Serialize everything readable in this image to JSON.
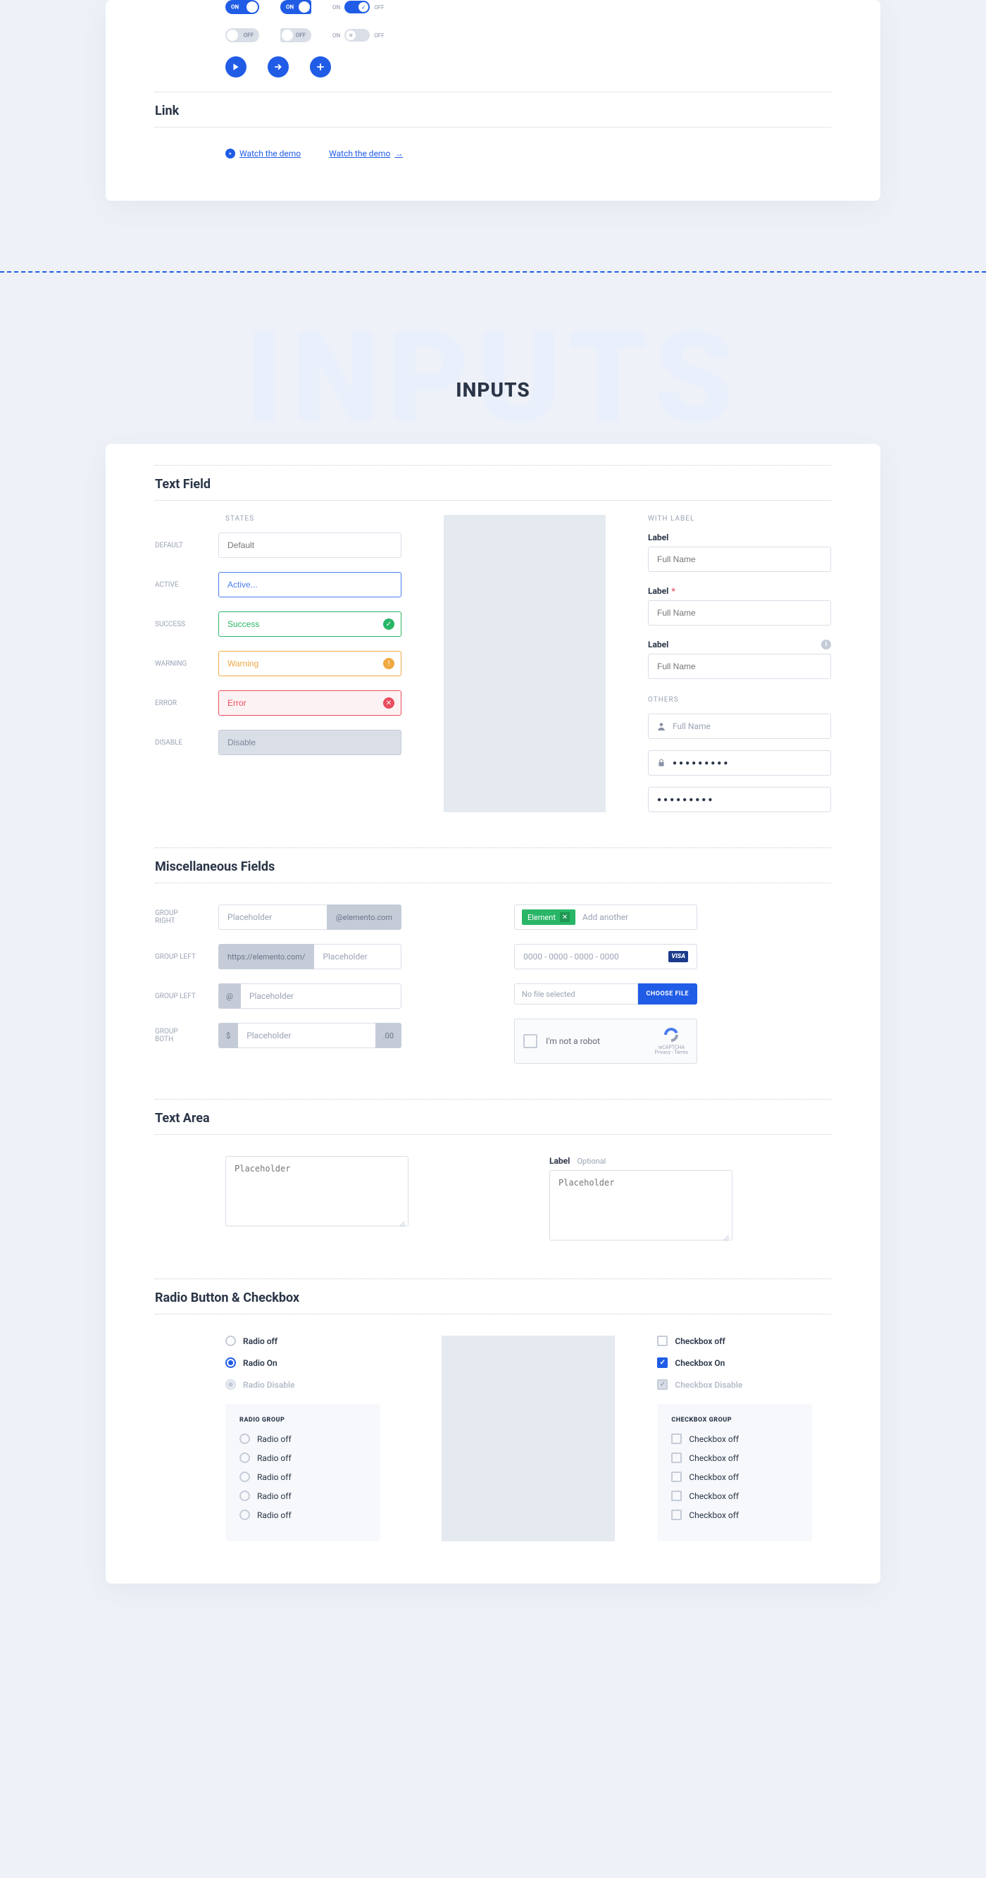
{
  "toggles": {
    "on": "ON",
    "off": "OFF"
  },
  "link": {
    "header": "Link",
    "watch1": "Watch the demo",
    "watch2": "Watch the demo"
  },
  "inputs_bg": "INPUTS",
  "inputs_title": "INPUTS",
  "textfield": {
    "header": "Text Field",
    "states_hdr": "STATES",
    "withlabel_hdr": "WITH LABEL",
    "others_hdr": "OTHERS",
    "default_lbl": "DEFAULT",
    "default_ph": "Default",
    "active_lbl": "ACTIVE",
    "active_ph": "Active...",
    "success_lbl": "SUCCESS",
    "success_ph": "Success",
    "warning_lbl": "WARNING",
    "warning_ph": "Warning",
    "error_lbl": "ERROR",
    "error_ph": "Error",
    "disable_lbl": "DISABLE",
    "disable_ph": "Disable",
    "label": "Label",
    "fullname": "Full Name",
    "password": "●●●●●●●●●",
    "password2": "●●●●●●●●●"
  },
  "misc": {
    "header": "Miscellaneous Fields",
    "gr_lbl": "GROUP RIGHT",
    "gr_ph": "Placeholder",
    "gr_addon": "@elemento.com",
    "gl_lbl": "GROUP LEFT",
    "gl_ph": "Placeholder",
    "gl_addon": "https://elemento.com/",
    "gl2_lbl": "GROUP LEFT",
    "gb_lbl": "GROUP BOTH",
    "gb_left": "$",
    "gb_right": ".00",
    "tag": "Element",
    "tag_ph": "Add another",
    "card_ph": "0000 - 0000 - 0000 - 0000",
    "visa": "VISA",
    "file_ph": "No file selected",
    "file_btn": "CHOOSE FILE",
    "captcha": "I'm not a robot",
    "captcha_logo": "reCAPTCHA",
    "captcha_sub": "Privacy - Terms"
  },
  "textarea": {
    "header": "Text Area",
    "ph": "Placeholder",
    "label": "Label",
    "optional": "Optional"
  },
  "radio": {
    "header": "Radio Button & Checkbox",
    "off": "Radio off",
    "on": "Radio On",
    "dis": "Radio Disable",
    "cb_off": "Checkbox off",
    "cb_on": "Checkbox On",
    "cb_dis": "Checkbox Disable",
    "rg_hdr": "RADIO GROUP",
    "cg_hdr": "CHECKBOX GROUP",
    "rg_item": "Radio off",
    "cg_item": "Checkbox off"
  }
}
